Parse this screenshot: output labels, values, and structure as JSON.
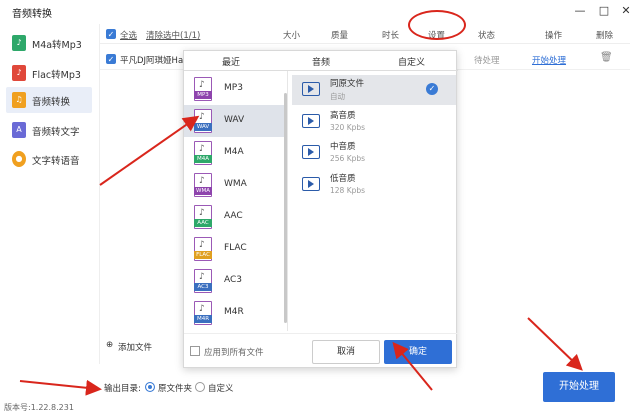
{
  "app": {
    "title": "音频转换"
  },
  "window": {
    "minimize": "—",
    "maximize": "□",
    "close": "✕"
  },
  "sidebar": {
    "items": [
      {
        "label": "M4a转Mp3",
        "icon": "m4a-icon",
        "color": "#2ea86a"
      },
      {
        "label": "Flac转Mp3",
        "icon": "flac-icon",
        "color": "#e0483a"
      },
      {
        "label": "音频转换",
        "icon": "music-note-icon",
        "color": "#f0a020"
      },
      {
        "label": "音频转文字",
        "icon": "text-a-icon",
        "color": "#6a6ad6"
      },
      {
        "label": "文字转语音",
        "icon": "speech-icon",
        "color": "#f0a020"
      }
    ],
    "active_index": 2
  },
  "list": {
    "select_all": "全选",
    "clear_selected": "清除选中(1/1)",
    "columns": [
      "大小",
      "质量",
      "时长",
      "设置",
      "状态",
      "操作",
      "删除"
    ],
    "row": {
      "name": "平凡DJ阿琪娅Ha...",
      "status": "待处理",
      "action": "开始处理"
    },
    "add_file": "添加文件"
  },
  "popup": {
    "tabs": [
      "最近",
      "音频",
      "自定义"
    ],
    "formats": [
      {
        "label": "MP3",
        "tag_color": "#8e44ad"
      },
      {
        "label": "WAV",
        "tag_color": "#3a6fbf"
      },
      {
        "label": "M4A",
        "tag_color": "#2ea86a"
      },
      {
        "label": "WMA",
        "tag_color": "#8e44ad"
      },
      {
        "label": "AAC",
        "tag_color": "#2ea86a"
      },
      {
        "label": "FLAC",
        "tag_color": "#e0a020"
      },
      {
        "label": "AC3",
        "tag_color": "#3a6fbf"
      },
      {
        "label": "M4R",
        "tag_color": "#3a6fbf"
      }
    ],
    "selected_format_index": 1,
    "qualities": [
      {
        "title": "同原文件",
        "sub": "自动"
      },
      {
        "title": "高音质",
        "sub": "320 Kpbs"
      },
      {
        "title": "中音质",
        "sub": "256 Kpbs"
      },
      {
        "title": "低音质",
        "sub": "128 Kpbs"
      }
    ],
    "selected_quality_index": 0,
    "apply_all": "应用到所有文件",
    "cancel": "取消",
    "ok": "确定"
  },
  "output": {
    "label": "输出目录:",
    "option_original": "原文件夹",
    "option_custom": "自定义",
    "selected": "original"
  },
  "start_button": "开始处理",
  "version": "版本号:1.22.8.231",
  "colors": {
    "accent": "#2f6fd6",
    "annotation": "#d9261c"
  }
}
